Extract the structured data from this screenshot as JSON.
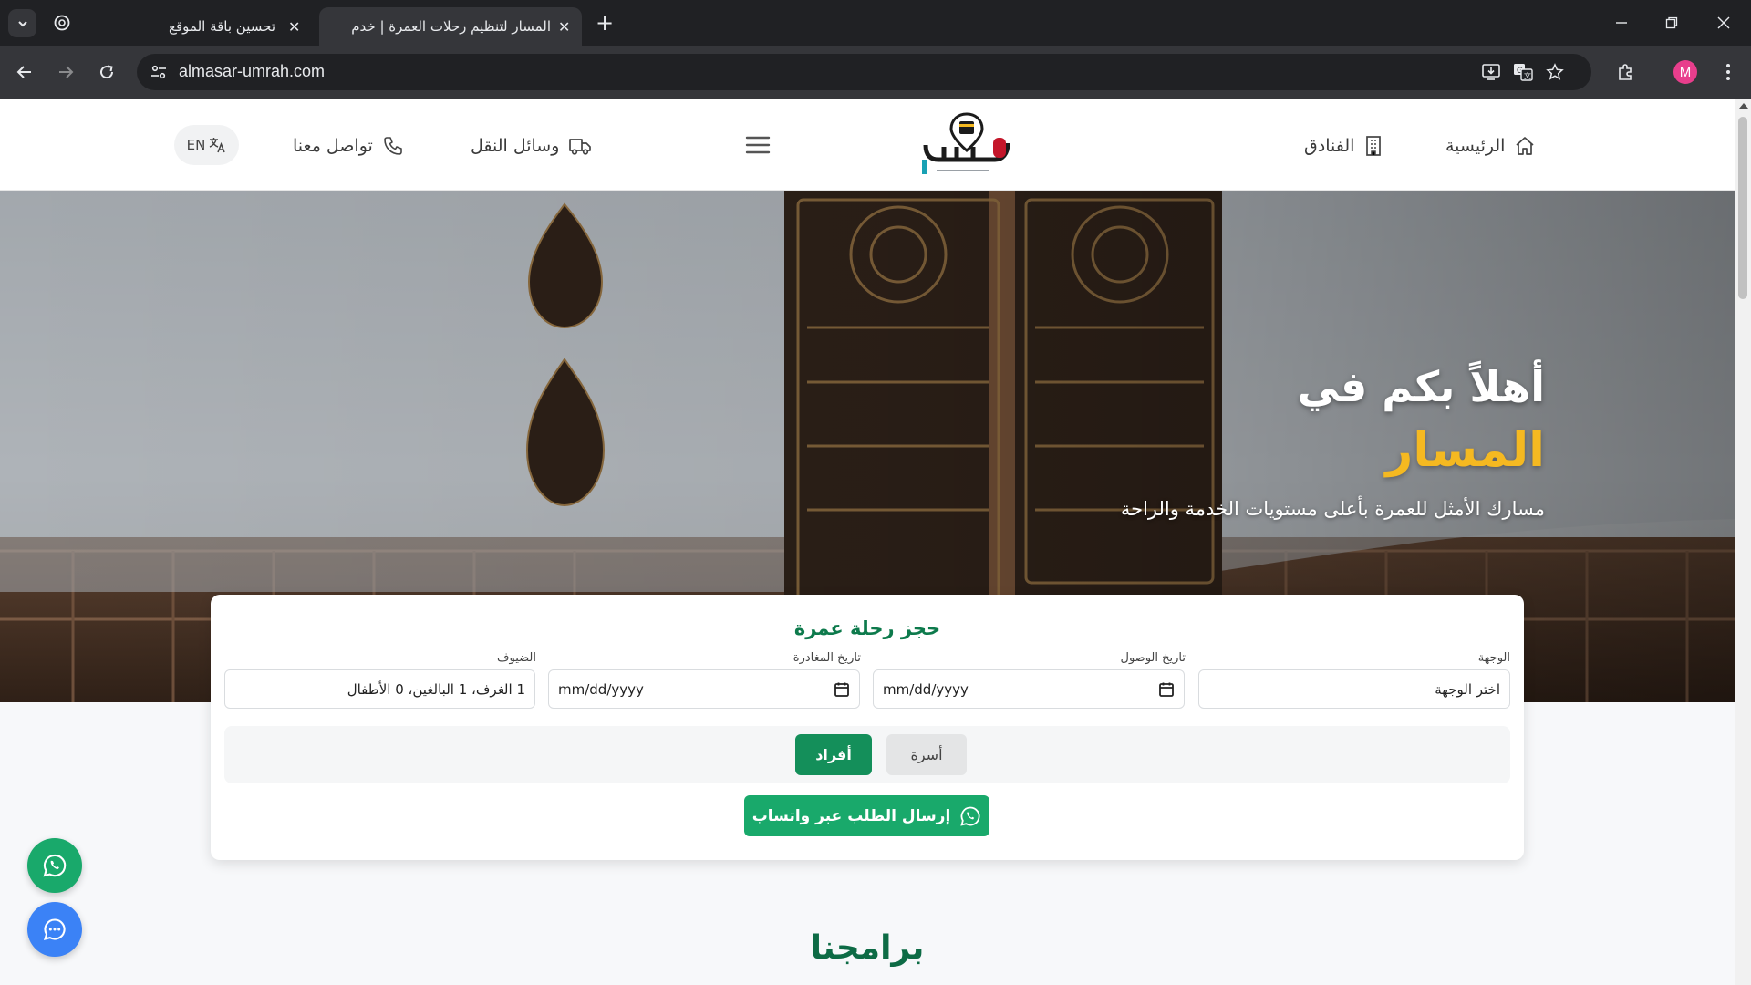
{
  "browser": {
    "tabs": [
      {
        "title": "تحسين باقة الموقع",
        "active": false
      },
      {
        "title": "المسار لتنظيم رحلات العمرة | خدم",
        "active": true
      }
    ],
    "url": "almasar-umrah.com",
    "profile_initial": "M"
  },
  "header": {
    "nav": {
      "home": "الرئيسية",
      "hotels": "الفنادق",
      "transport": "وسائل النقل",
      "contact": "تواصل معنا"
    },
    "lang_label": "EN"
  },
  "hero": {
    "title_line1": "أهلاً بكم في",
    "title_line2": "المسار",
    "subtitle": "مسارك الأمثل للعمرة بأعلى مستويات الخدمة والراحة"
  },
  "booking": {
    "title": "حجز رحلة عمرة",
    "destination": {
      "label": "الوجهة",
      "value": "اختر الوجهة"
    },
    "arrival": {
      "label": "تاريخ الوصول",
      "placeholder": "mm/dd/yyyy"
    },
    "departure": {
      "label": "تاريخ المغادرة",
      "placeholder": "mm/dd/yyyy"
    },
    "guests": {
      "label": "الضيوف",
      "value": "1 الغرف، 1 البالغين، 0 الأطفال"
    },
    "types": {
      "family": "أسرة",
      "individuals": "أفراد",
      "selected": "individuals"
    },
    "whatsapp_button": "إرسال الطلب عبر واتساب"
  },
  "programs_title": "برامجنا",
  "colors": {
    "brand_green": "#148f5a",
    "whatsapp_green": "#19a96b",
    "gold": "#f5b921",
    "chat_blue": "#3b82f6"
  }
}
